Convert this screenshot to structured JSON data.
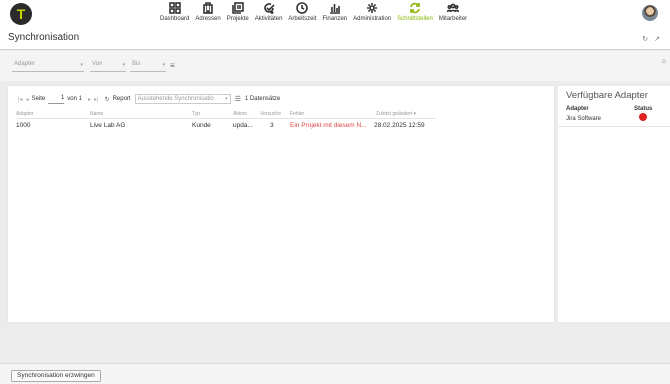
{
  "app": {
    "logo_letter": "T"
  },
  "nav": {
    "items": [
      {
        "label": "Dashboard",
        "icon": "dashboard-icon"
      },
      {
        "label": "Adressen",
        "icon": "building-icon"
      },
      {
        "label": "Projekte",
        "icon": "projects-icon"
      },
      {
        "label": "Aktivitäten",
        "icon": "activity-icon"
      },
      {
        "label": "Arbeitszeit",
        "icon": "clock-icon"
      },
      {
        "label": "Finanzen",
        "icon": "bar-chart-icon"
      },
      {
        "label": "Administration",
        "icon": "gear-icon"
      },
      {
        "label": "Schnittstellen",
        "icon": "sync-icon",
        "active": true
      },
      {
        "label": "Mitarbeiter",
        "icon": "people-icon"
      }
    ],
    "active_color": "#8ab400"
  },
  "page": {
    "title": "Synchronisation"
  },
  "filters": {
    "adapter_placeholder": "Adapter",
    "von_placeholder": "Von",
    "bis_placeholder": "Bis"
  },
  "pager": {
    "seite_label": "Seite",
    "page_value": "1",
    "of_label": "von 1",
    "report_label": "Report",
    "report_value": "Ausstehende Synchronisatio",
    "records_label": "1 Datensätze"
  },
  "grid": {
    "columns": [
      "Adapter",
      "Name",
      "Typ",
      "Aktion",
      "Versuche",
      "Fehler",
      "Zuletzt geändert"
    ],
    "rows": [
      {
        "adapter": "1000",
        "name": "Live Lab AG",
        "typ": "Kunde",
        "aktion": "upda...",
        "versuche": "3",
        "fehler": "Ein Projekt mit diesem N...",
        "zuletzt": "28.02.2025 12:59"
      }
    ]
  },
  "side": {
    "title": "Verfügbare Adapter",
    "col_adapter": "Adapter",
    "col_status": "Status",
    "adapters": [
      {
        "name": "Jira Software",
        "status": "error",
        "color": "#e02020"
      }
    ]
  },
  "footer": {
    "force_button": "Synchronisation erzwingen"
  }
}
